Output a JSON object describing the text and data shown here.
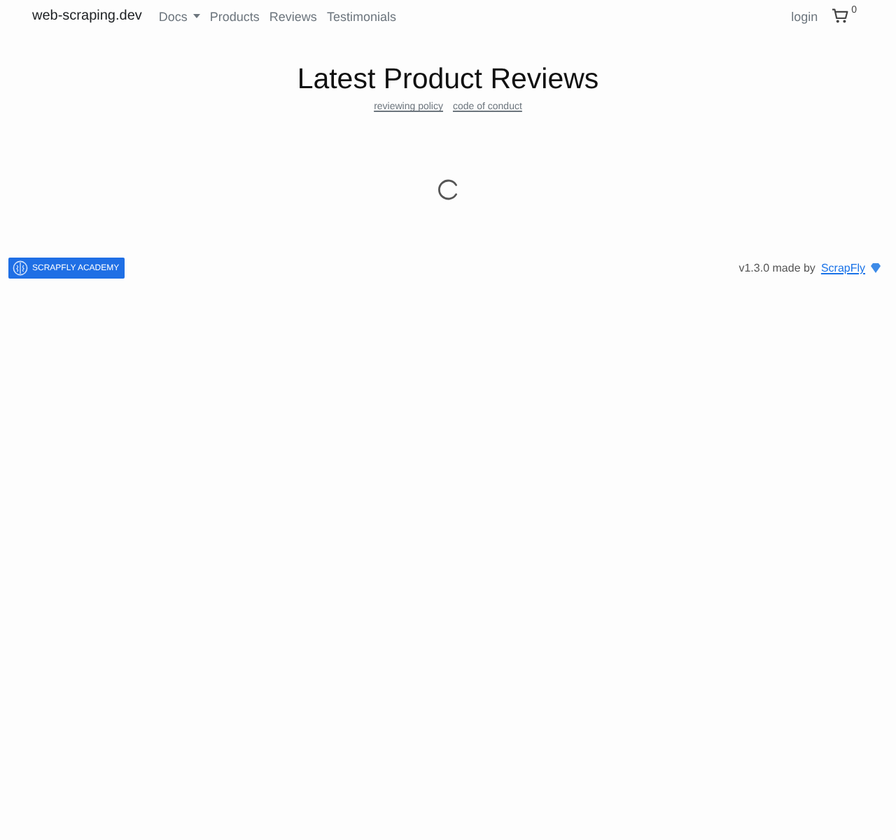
{
  "navbar": {
    "brand": "web-scraping.dev",
    "links": [
      {
        "label": "Docs",
        "kind": "dropdown"
      },
      {
        "label": "Products",
        "kind": "link"
      },
      {
        "label": "Reviews",
        "kind": "link"
      },
      {
        "label": "Testimonials",
        "kind": "link"
      }
    ],
    "login": "login",
    "cart_count": "0"
  },
  "header": {
    "title": "Latest Product Reviews",
    "links": [
      "reviewing policy",
      "code of conduct"
    ]
  },
  "loading": true,
  "footer": {
    "academy_button": "SCRAPFLY ACADEMY",
    "version": "v1.3.0 made by",
    "credit_link": "ScrapFly"
  }
}
